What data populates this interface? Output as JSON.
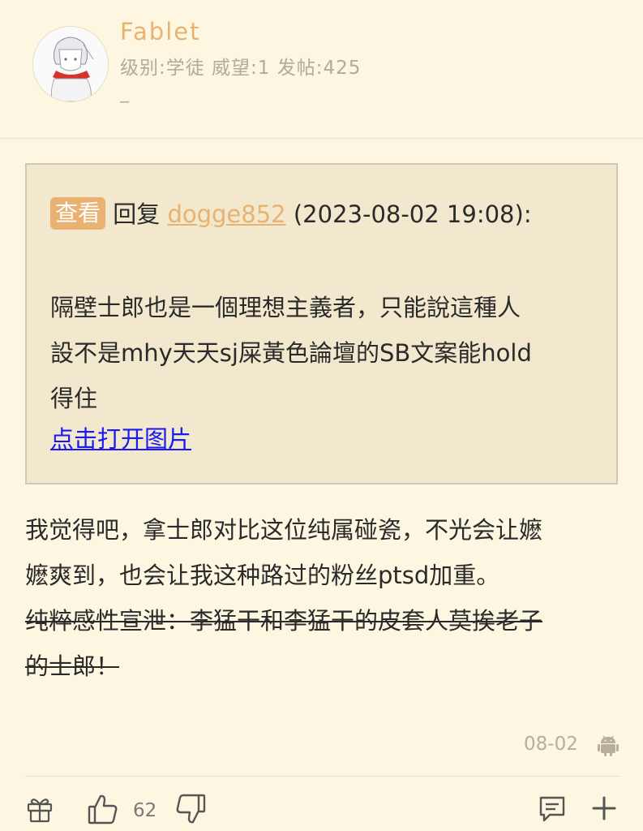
{
  "user": {
    "name": "Fablet",
    "info": "级别:学徒 威望:1 发帖:425",
    "signature": "_"
  },
  "quote": {
    "view_label": "查看",
    "reply_label": "回复",
    "reply_user": "dogge852",
    "reply_time": "(2023-08-02 19:08):",
    "lines": [
      "隔壁士郎也是一個理想主義者，只能說這種人",
      "設不是mhy天天sj屎黃色論壇的SB文案能hold",
      "得住"
    ],
    "image_link": "点击打开图片"
  },
  "post": {
    "lines": [
      "我觉得吧，拿士郎对比这位纯属碰瓷，不光会让嬷",
      "嬷爽到，也会让我这种路过的粉丝ptsd加重。"
    ],
    "strike_lines": [
      "纯粹感性宣泄：李猛干和李猛干的皮套人莫挨老子",
      "的士郎！"
    ]
  },
  "meta": {
    "date": "08-02"
  },
  "toolbar": {
    "like_count": "62"
  },
  "colors": {
    "background": "#fdf6e0",
    "accent": "#e8b271",
    "quote_bg": "#f1e8cd",
    "link": "#1a1aee",
    "muted": "#b3ab98"
  },
  "icons": [
    "avatar",
    "android-icon",
    "gift-icon",
    "thumbs-up-icon",
    "thumbs-down-icon",
    "comment-icon",
    "plus-icon"
  ]
}
